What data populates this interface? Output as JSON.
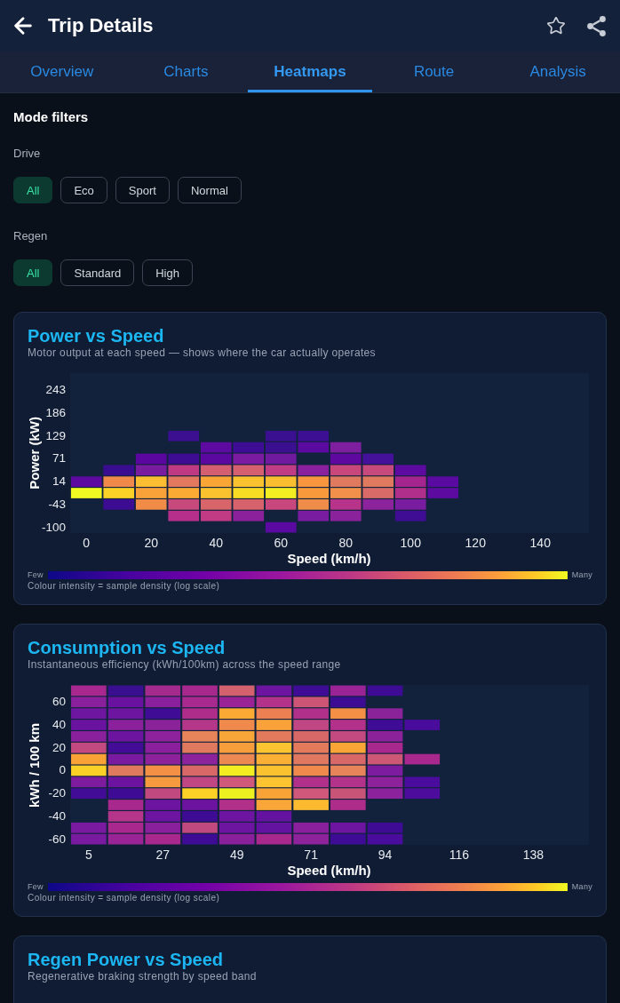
{
  "header": {
    "title": "Trip Details"
  },
  "tabs": [
    {
      "label": "Overview",
      "selected": false
    },
    {
      "label": "Charts",
      "selected": false
    },
    {
      "label": "Heatmaps",
      "selected": true
    },
    {
      "label": "Route",
      "selected": false
    },
    {
      "label": "Analysis",
      "selected": false
    }
  ],
  "filters": {
    "title": "Mode filters",
    "groups": [
      {
        "label": "Drive",
        "chips": [
          {
            "label": "All",
            "selected": true
          },
          {
            "label": "Eco",
            "selected": false
          },
          {
            "label": "Sport",
            "selected": false
          },
          {
            "label": "Normal",
            "selected": false
          }
        ]
      },
      {
        "label": "Regen",
        "chips": [
          {
            "label": "All",
            "selected": true
          },
          {
            "label": "Standard",
            "selected": false
          },
          {
            "label": "High",
            "selected": false
          }
        ]
      }
    ]
  },
  "cards": [
    {
      "title": "Power vs Speed",
      "subtitle": "Motor output at each speed — shows where the car actually operates",
      "heatmap": {
        "y_label": "Power (kW)",
        "y_ticks": [
          "243",
          "186",
          "129",
          "71",
          "14",
          "-43",
          "-100"
        ],
        "x_ticks": [
          "0",
          "20",
          "40",
          "60",
          "80",
          "100",
          "120",
          "140"
        ],
        "x_label": "Speed (km/h)",
        "legend": {
          "low": "Few",
          "high": "Many",
          "caption": "Colour intensity = sample density (log scale)"
        }
      }
    },
    {
      "title": "Consumption vs Speed",
      "subtitle": "Instantaneous efficiency (kWh/100km) across the speed range",
      "heatmap": {
        "y_label": "kWh / 100 km",
        "y_ticks": [
          "60",
          "40",
          "20",
          "0",
          "-20",
          "-40",
          "-60"
        ],
        "x_ticks": [
          "5",
          "27",
          "49",
          "71",
          "94",
          "116",
          "138"
        ],
        "x_label": "Speed (km/h)",
        "legend": {
          "low": "Few",
          "high": "Many",
          "caption": "Colour intensity = sample density (log scale)"
        }
      }
    },
    {
      "title": "Regen Power vs Speed",
      "subtitle": "Regenerative braking strength by speed band"
    }
  ]
}
